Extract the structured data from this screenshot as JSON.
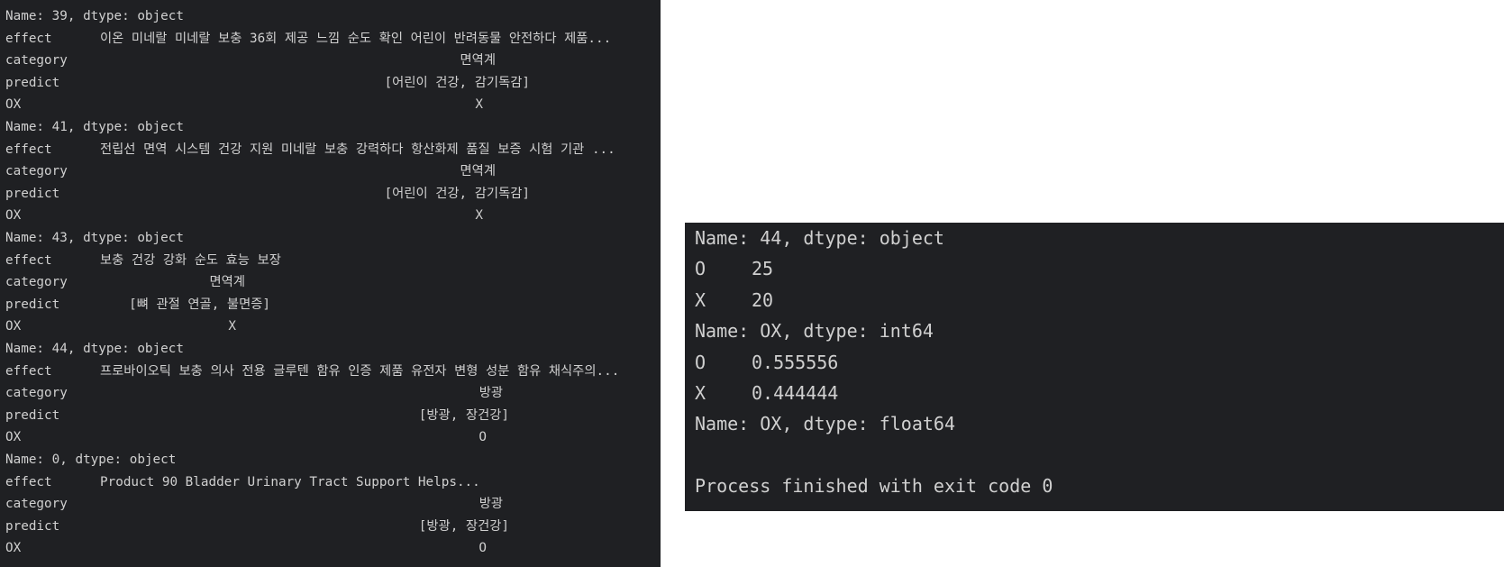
{
  "left_console": {
    "records": [
      {
        "header": "Name: 39, dtype: object",
        "rows": [
          {
            "key": "effect",
            "value": "이온 미네랄 미네랄 보충 36회 제공 느낌 순도 확인 어린이 반려동물 안전하다 제품..."
          },
          {
            "key": "category",
            "value": "면역계"
          },
          {
            "key": "predict",
            "value": "[어린이 건강, 감기독감]"
          },
          {
            "key": "OX",
            "value": "X"
          }
        ]
      },
      {
        "header": "Name: 41, dtype: object",
        "rows": [
          {
            "key": "effect",
            "value": "전립선 면역 시스템 건강 지원 미네랄 보충 강력하다 항산화제 품질 보증 시험 기관 ..."
          },
          {
            "key": "category",
            "value": "면역계"
          },
          {
            "key": "predict",
            "value": "[어린이 건강, 감기독감]"
          },
          {
            "key": "OX",
            "value": "X"
          }
        ]
      },
      {
        "header": "Name: 43, dtype: object",
        "rows": [
          {
            "key": "effect",
            "value": "보충 건강 강화 순도 효능 보장"
          },
          {
            "key": "category",
            "value": "면역계"
          },
          {
            "key": "predict",
            "value": "[뼈 관절 연골, 불면증]"
          },
          {
            "key": "OX",
            "value": "X"
          }
        ]
      },
      {
        "header": "Name: 44, dtype: object",
        "rows": [
          {
            "key": "effect",
            "value": "프로바이오틱 보충 의사 전용 글루텐 함유 인증 제품 유전자 변형 성분 함유 채식주의..."
          },
          {
            "key": "category",
            "value": "방광"
          },
          {
            "key": "predict",
            "value": "[방광, 장건강]"
          },
          {
            "key": "OX",
            "value": "O"
          }
        ]
      },
      {
        "header": "Name: 0, dtype: object",
        "rows": [
          {
            "key": "effect",
            "value": "Product 90 Bladder Urinary Tract Support Helps..."
          },
          {
            "key": "category",
            "value": "방광"
          },
          {
            "key": "predict",
            "value": "[방광, 장건강]"
          },
          {
            "key": "OX",
            "value": "O"
          }
        ]
      }
    ]
  },
  "right_console": {
    "lines": [
      {
        "label": "Name: 44, dtype: object"
      },
      {
        "key": "O",
        "value": "25"
      },
      {
        "key": "X",
        "value": "20"
      },
      {
        "label": "Name: OX, dtype: int64"
      },
      {
        "key": "O",
        "value": "0.555556"
      },
      {
        "key": "X",
        "value": "0.444444"
      },
      {
        "label": "Name: OX, dtype: float64"
      },
      {
        "label": ""
      },
      {
        "label": "Process finished with exit code 0"
      }
    ]
  }
}
